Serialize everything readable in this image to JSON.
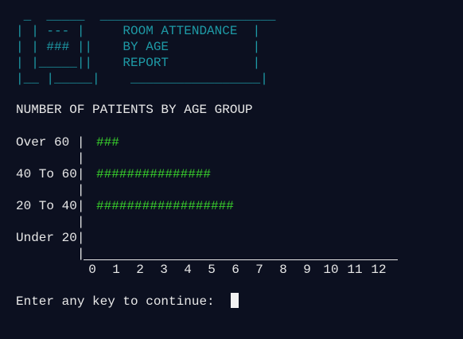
{
  "banner": {
    "lines": [
      " _  _____  _______________________",
      "| | --- |     ROOM ATTENDANCE  |",
      "| | ### ||    BY AGE           |",
      "| |_____||    REPORT           |",
      "|__ |_____|    _________________|"
    ]
  },
  "chart_data": {
    "type": "bar",
    "orientation": "horizontal",
    "title": "NUMBER OF PATIENTS BY AGE GROUP",
    "categories": [
      "Over 60",
      "40 To 60",
      "20 To 40",
      "Under 20"
    ],
    "values": [
      1,
      5,
      6,
      0
    ],
    "xlim": [
      0,
      12
    ],
    "xticks": [
      "0",
      "1",
      "2",
      "3",
      "4",
      "5",
      "6",
      "7",
      "8",
      "9",
      "10",
      "11",
      "12"
    ],
    "bar_char": "#",
    "bar_color": "#39d02c",
    "rows": [
      {
        "label": "Over 60 |",
        "bar": "###"
      },
      {
        "label": "40 To 60|",
        "bar": "###############"
      },
      {
        "label": "20 To 40|",
        "bar": "##################"
      },
      {
        "label": "Under 20|",
        "bar": ""
      }
    ],
    "separator": "        |"
  },
  "prompt": {
    "text": "Enter any key to continue: "
  },
  "colors": {
    "background": "#0c1020",
    "text": "#e8e8e8",
    "banner": "#1e9aa6",
    "bars": "#39d02c"
  }
}
